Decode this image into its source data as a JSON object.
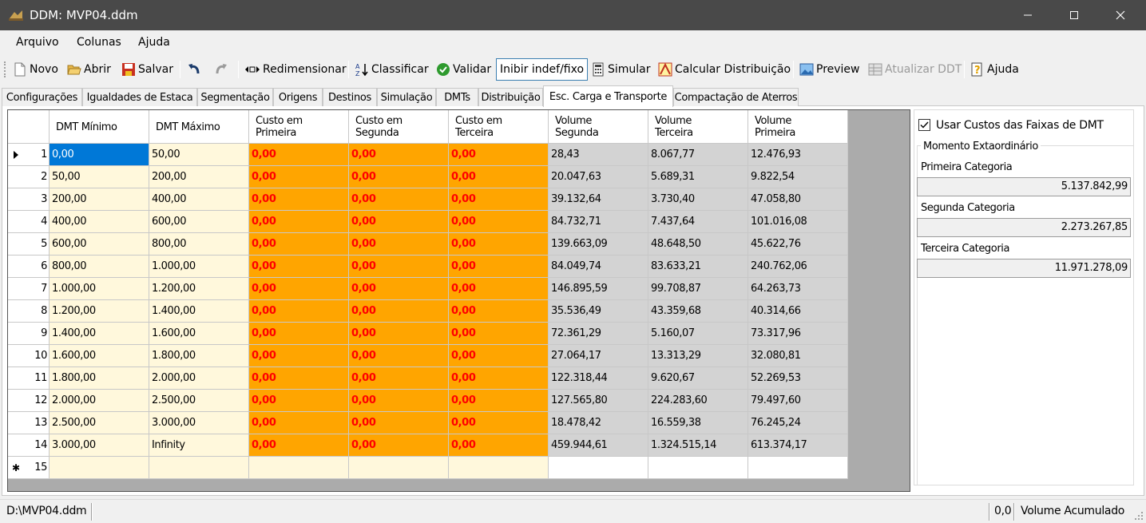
{
  "window": {
    "title": "DDM: MVP04.ddm"
  },
  "menu": [
    "Arquivo",
    "Colunas",
    "Ajuda"
  ],
  "toolbar": {
    "novo": "Novo",
    "abrir": "Abrir",
    "salvar": "Salvar",
    "redimensionar": "Redimensionar",
    "classificar": "Classificar",
    "validar": "Validar",
    "inibir": "Inibir indef/fixo",
    "simular": "Simular",
    "calcular": "Calcular Distribuição",
    "preview": "Preview",
    "atualizar": "Atualizar DDT",
    "ajuda": "Ajuda"
  },
  "tabs": [
    "Configurações",
    "Igualdades de Estaca",
    "Segmentação",
    "Origens",
    "Destinos",
    "Simulação",
    "DMTs",
    "Distribuição",
    "Esc. Carga e Transporte",
    "Compactação de Aterros"
  ],
  "active_tab": "Esc. Carga e Transporte",
  "grid": {
    "headers": [
      [
        "DMT Mínimo",
        ""
      ],
      [
        "DMT Máximo",
        ""
      ],
      [
        "Custo em",
        "Primeira"
      ],
      [
        "Custo em",
        "Segunda"
      ],
      [
        "Custo em",
        "Terceira"
      ],
      [
        "Volume",
        "Segunda"
      ],
      [
        "Volume",
        "Terceira"
      ],
      [
        "Volume",
        "Primeira"
      ]
    ],
    "rows": [
      [
        "1",
        "0,00",
        "50,00",
        "0,00",
        "0,00",
        "0,00",
        "28,43",
        "8.067,77",
        "12.476,93"
      ],
      [
        "2",
        "50,00",
        "200,00",
        "0,00",
        "0,00",
        "0,00",
        "20.047,63",
        "5.689,31",
        "9.822,54"
      ],
      [
        "3",
        "200,00",
        "400,00",
        "0,00",
        "0,00",
        "0,00",
        "39.132,64",
        "3.730,40",
        "47.058,80"
      ],
      [
        "4",
        "400,00",
        "600,00",
        "0,00",
        "0,00",
        "0,00",
        "84.732,71",
        "7.437,64",
        "101.016,08"
      ],
      [
        "5",
        "600,00",
        "800,00",
        "0,00",
        "0,00",
        "0,00",
        "139.663,09",
        "48.648,50",
        "45.622,76"
      ],
      [
        "6",
        "800,00",
        "1.000,00",
        "0,00",
        "0,00",
        "0,00",
        "84.049,74",
        "83.633,21",
        "240.762,06"
      ],
      [
        "7",
        "1.000,00",
        "1.200,00",
        "0,00",
        "0,00",
        "0,00",
        "146.895,59",
        "99.708,87",
        "64.263,73"
      ],
      [
        "8",
        "1.200,00",
        "1.400,00",
        "0,00",
        "0,00",
        "0,00",
        "35.536,49",
        "43.359,68",
        "40.314,66"
      ],
      [
        "9",
        "1.400,00",
        "1.600,00",
        "0,00",
        "0,00",
        "0,00",
        "72.361,29",
        "5.160,07",
        "73.317,96"
      ],
      [
        "10",
        "1.600,00",
        "1.800,00",
        "0,00",
        "0,00",
        "0,00",
        "27.064,17",
        "13.313,29",
        "32.080,81"
      ],
      [
        "11",
        "1.800,00",
        "2.000,00",
        "0,00",
        "0,00",
        "0,00",
        "122.318,44",
        "9.620,67",
        "52.269,53"
      ],
      [
        "12",
        "2.000,00",
        "2.500,00",
        "0,00",
        "0,00",
        "0,00",
        "127.565,80",
        "224.283,60",
        "79.497,60"
      ],
      [
        "13",
        "2.500,00",
        "3.000,00",
        "0,00",
        "0,00",
        "0,00",
        "18.478,42",
        "16.559,38",
        "76.245,24"
      ],
      [
        "14",
        "3.000,00",
        "Infinity",
        "0,00",
        "0,00",
        "0,00",
        "459.944,61",
        "1.324.515,14",
        "613.374,17"
      ]
    ],
    "new_row_number": "15",
    "colors": {
      "min_max": "#fff8dc",
      "custo": "#ffa500",
      "custo_text": "#ff0000",
      "volume": "#d3d3d3",
      "selection": "#0078d7"
    }
  },
  "panel": {
    "checkbox_label": "Usar Custos das Faixas de DMT",
    "checkbox_checked": true,
    "group_title": "Momento Extaordinário",
    "primeira_label": "Primeira Categoria",
    "primeira_value": "5.137.842,99",
    "segunda_label": "Segunda Categoria",
    "segunda_value": "2.273.267,85",
    "terceira_label": "Terceira Categoria",
    "terceira_value": "11.971.278,09"
  },
  "status": {
    "path": "D:\\MVP04.ddm",
    "value": "0,0",
    "label": "Volume Acumulado"
  }
}
